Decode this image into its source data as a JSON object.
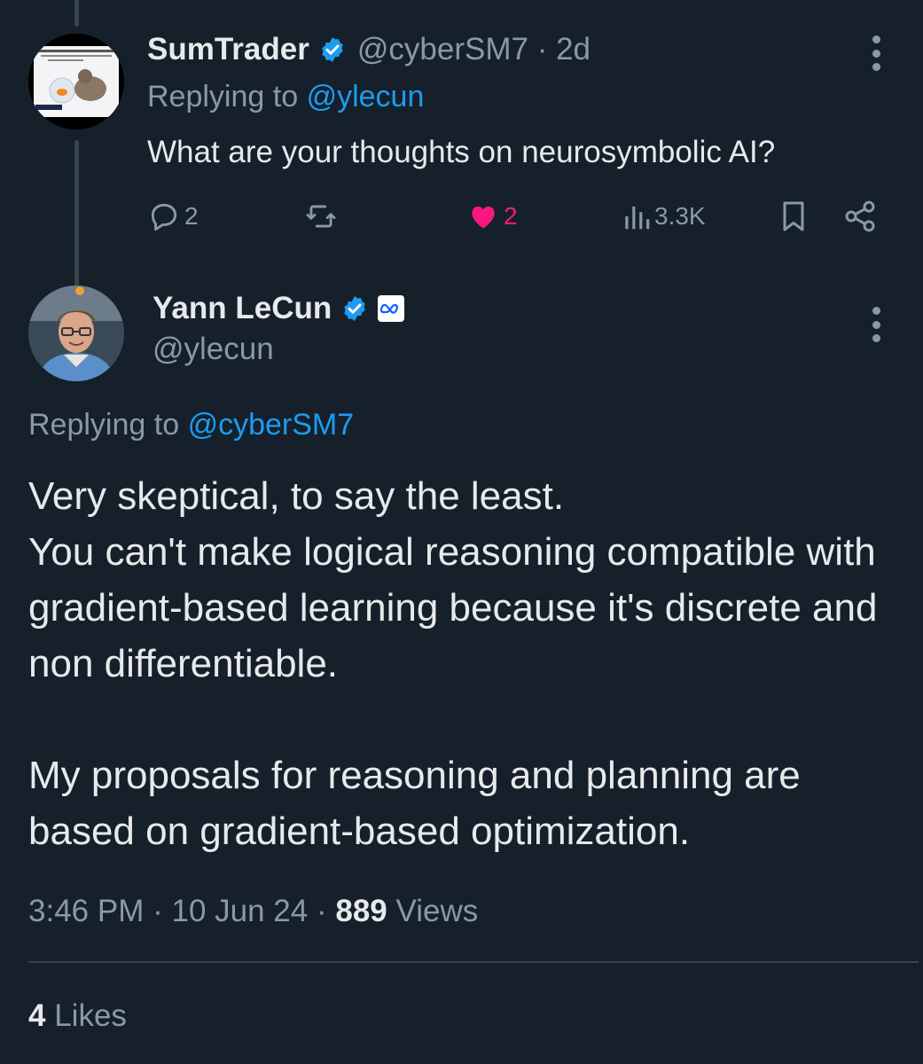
{
  "reply_tweet": {
    "author_name": "SumTrader",
    "handle": "@cyberSM7",
    "separator": "·",
    "time_ago": "2d",
    "replying_prefix": "Replying to",
    "replying_to": "@ylecun",
    "text": "What are your thoughts on neurosymbolic AI?",
    "actions": {
      "reply_count": "2",
      "retweet_count": "",
      "like_count": "2",
      "views_count": "3.3K"
    },
    "icons": [
      "reply-icon",
      "retweet-icon",
      "heart-icon",
      "views-icon",
      "bookmark-icon",
      "share-icon",
      "more-icon"
    ]
  },
  "main_tweet": {
    "author_name": "Yann LeCun",
    "handle": "@ylecun",
    "affiliation_icon": "meta-logo-icon",
    "replying_prefix": "Replying to",
    "replying_to": "@cyberSM7",
    "body": {
      "line1": "Very skeptical, to say the least.",
      "line2": "You can't make logical reasoning compatible with gradient-based learning because it's discrete and non differentiable.",
      "line3": "My proposals for reasoning and planning are based on gradient-based optimization."
    },
    "time": "3:46 PM",
    "date": "10 Jun 24",
    "views_count": "889",
    "views_label": "Views",
    "likes_count": "4",
    "likes_label": "Likes"
  },
  "colors": {
    "background": "#15202b",
    "text_primary": "#e7e9ea",
    "text_secondary": "#8b98a5",
    "link": "#1d9bf0",
    "like_pink": "#f91880",
    "divider": "#38444d"
  }
}
